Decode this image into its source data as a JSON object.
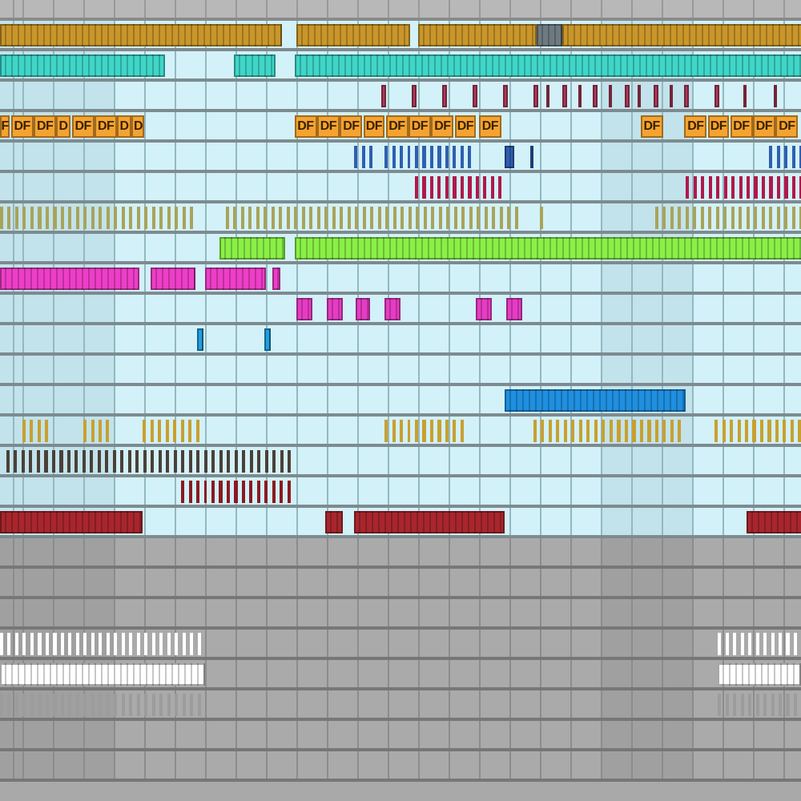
{
  "arrangement": {
    "tracks": [
      {
        "color": "#c9962a",
        "clips": [
          {
            "kind": "block"
          },
          {
            "kind": "block"
          },
          {
            "kind": "block"
          },
          {
            "kind": "block",
            "color": "#6d7a82"
          },
          {
            "kind": "block"
          }
        ]
      },
      {
        "color": "#3fd6c8",
        "clips": [
          {
            "kind": "block"
          },
          {
            "kind": "block"
          },
          {
            "kind": "block"
          }
        ]
      },
      {
        "color": "#b03a5a",
        "clips": [
          {
            "kind": "block"
          },
          {
            "kind": "block"
          },
          {
            "kind": "block"
          },
          {
            "kind": "block"
          },
          {
            "kind": "block"
          },
          {
            "kind": "block"
          },
          {
            "kind": "block"
          },
          {
            "kind": "block"
          },
          {
            "kind": "block"
          },
          {
            "kind": "block"
          },
          {
            "kind": "block"
          },
          {
            "kind": "block"
          },
          {
            "kind": "block"
          },
          {
            "kind": "block"
          },
          {
            "kind": "block"
          },
          {
            "kind": "block"
          },
          {
            "kind": "block"
          },
          {
            "kind": "block"
          },
          {
            "kind": "block"
          }
        ]
      },
      {
        "color": "#f5a330",
        "clips": [
          {
            "kind": "block",
            "label": "F"
          },
          {
            "kind": "block",
            "label": "DF"
          },
          {
            "kind": "block",
            "label": "DF"
          },
          {
            "kind": "block",
            "label": "D"
          },
          {
            "kind": "block",
            "label": "DF"
          },
          {
            "kind": "block",
            "label": "DF"
          },
          {
            "kind": "block",
            "label": "D"
          },
          {
            "kind": "block",
            "label": "D"
          },
          {
            "kind": "block",
            "label": "DF"
          },
          {
            "kind": "block",
            "label": "DF"
          },
          {
            "kind": "block",
            "label": "DF"
          },
          {
            "kind": "block",
            "label": "DF"
          },
          {
            "kind": "block",
            "label": "DF"
          },
          {
            "kind": "block",
            "label": "DF"
          },
          {
            "kind": "block",
            "label": "DF"
          },
          {
            "kind": "block",
            "label": "DF"
          },
          {
            "kind": "block",
            "label": "DF"
          },
          {
            "kind": "block",
            "label": "DF"
          },
          {
            "kind": "block",
            "label": "DF"
          },
          {
            "kind": "block",
            "label": "DF"
          },
          {
            "kind": "block",
            "label": "DF"
          },
          {
            "kind": "block",
            "label": "DF"
          },
          {
            "kind": "block",
            "label": "DF"
          }
        ]
      },
      {
        "color": "#2f5fb0",
        "clips": [
          {
            "kind": "notes"
          },
          {
            "kind": "notes"
          },
          {
            "kind": "block"
          },
          {
            "kind": "block"
          },
          {
            "kind": "notes"
          }
        ]
      },
      {
        "color": "#b0184a",
        "clips": [
          {
            "kind": "notes"
          },
          {
            "kind": "notes"
          }
        ]
      },
      {
        "color": "#a9a35a",
        "clips": [
          {
            "kind": "notes"
          },
          {
            "kind": "notes"
          },
          {
            "kind": "notes"
          },
          {
            "kind": "notes"
          }
        ]
      },
      {
        "color": "#8af046",
        "clips": [
          {
            "kind": "block"
          },
          {
            "kind": "block"
          }
        ]
      },
      {
        "color": "#ee3ec8",
        "clips": [
          {
            "kind": "block"
          },
          {
            "kind": "block"
          },
          {
            "kind": "block"
          },
          {
            "kind": "block"
          }
        ]
      },
      {
        "color": "#e63cc4",
        "clips": [
          {
            "kind": "block"
          },
          {
            "kind": "block"
          },
          {
            "kind": "block"
          },
          {
            "kind": "block"
          },
          {
            "kind": "block"
          },
          {
            "kind": "block"
          }
        ]
      },
      {
        "color": "#1f9fe0",
        "clips": [
          {
            "kind": "block"
          },
          {
            "kind": "block"
          }
        ]
      },
      {
        "color": "#1f8fe0",
        "clips": [
          {
            "kind": "block"
          }
        ]
      },
      {
        "color": "#c8a030",
        "clips": [
          {
            "kind": "notes"
          },
          {
            "kind": "notes"
          },
          {
            "kind": "notes"
          },
          {
            "kind": "notes"
          },
          {
            "kind": "notes"
          },
          {
            "kind": "notes"
          }
        ]
      },
      {
        "color": "#4a4038",
        "clips": [
          {
            "kind": "notes"
          }
        ]
      },
      {
        "color": "#8a1a22",
        "clips": [
          {
            "kind": "notes"
          }
        ]
      },
      {
        "color": "#a8262c",
        "clips": [
          {
            "kind": "block"
          },
          {
            "kind": "block"
          },
          {
            "kind": "block"
          },
          {
            "kind": "block"
          }
        ]
      }
    ],
    "lower_tracks": [
      {
        "color": "#ffffff",
        "clips": [
          {
            "kind": "notes"
          },
          {
            "kind": "notes"
          }
        ]
      },
      {
        "color": "#ffffff",
        "clips": [
          {
            "kind": "block"
          },
          {
            "kind": "block"
          }
        ]
      },
      {
        "color": "#9c9c9c",
        "clips": [
          {
            "kind": "notes"
          },
          {
            "kind": "notes"
          }
        ]
      }
    ]
  }
}
